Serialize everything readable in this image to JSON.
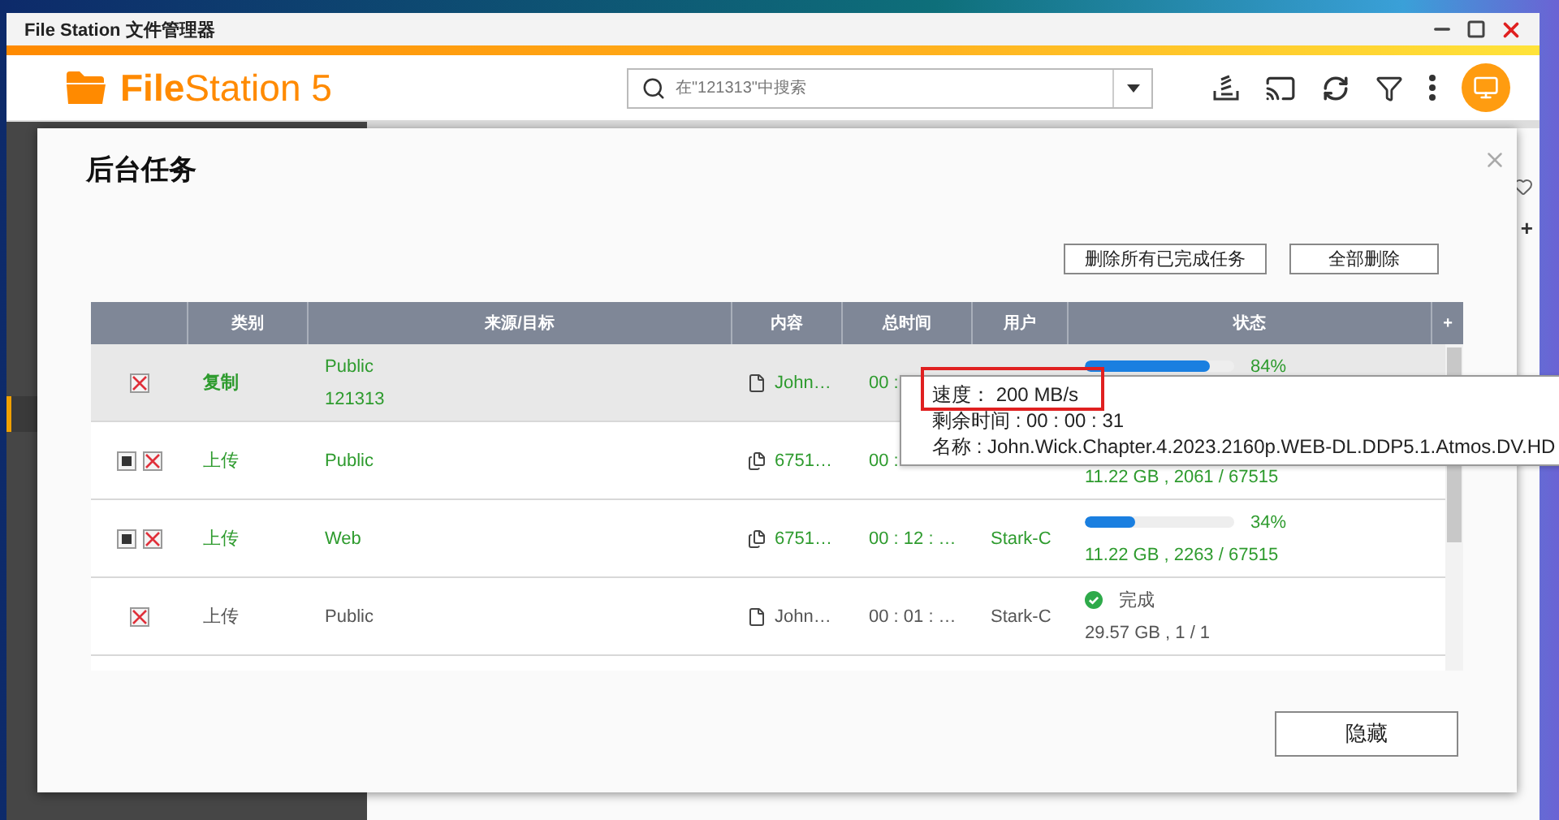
{
  "window": {
    "title": "File Station 文件管理器"
  },
  "app": {
    "logo": "**File**Station 5",
    "search": {
      "placeholder": "在\"121313\"中搜索"
    },
    "side_add": "+"
  },
  "dialog": {
    "title": "后台任务",
    "actions": [
      "删除所有已完成任务",
      "全部删除"
    ],
    "hide_button": "隐藏"
  },
  "table": {
    "columns": [
      "类别",
      "来源/目标",
      "内容",
      "总时间",
      "用户",
      "状态"
    ],
    "add_column": "+",
    "rows": [
      {
        "selected": true,
        "kind": "running",
        "actions": [
          {
            "kind": "cancel"
          }
        ],
        "type": "复制",
        "source": "Public",
        "target": "121313",
        "content": {
          "kind": "file",
          "text": "John…"
        },
        "time": "00 :",
        "level": 0.84,
        "percent": "84%"
      },
      {
        "selected": false,
        "kind": "running",
        "actions": [
          {
            "kind": "stop"
          },
          {
            "kind": "cancel"
          }
        ],
        "type": "上传",
        "source": "Public",
        "content": {
          "kind": "files",
          "text": "6751…"
        },
        "time": "00 :",
        "detail": "11.22 GB , 2061 / 67515"
      },
      {
        "selected": false,
        "kind": "running",
        "actions": [
          {
            "kind": "stop"
          },
          {
            "kind": "cancel"
          }
        ],
        "type": "上传",
        "source": "Web",
        "content": {
          "kind": "files",
          "text": "6751…"
        },
        "time": "00 : 12 : …",
        "user": "Stark-C",
        "level": 0.34,
        "percent": "34%",
        "detail": "11.22 GB , 2263 / 67515"
      },
      {
        "selected": false,
        "kind": "done",
        "actions": [
          {
            "kind": "cancel"
          }
        ],
        "type": "上传",
        "source": "Public",
        "content": {
          "kind": "file",
          "text": "John…"
        },
        "time": "00 : 01 : …",
        "user": "Stark-C",
        "state_label": "完成",
        "detail": "29.57 GB , 1 / 1"
      }
    ]
  },
  "tooltip": {
    "lines": [
      {
        "text": "速度： 200 MB/s",
        "highlighted": true
      },
      {
        "text": "剩余时间 : 00 : 00 : 31",
        "highlighted": false
      },
      {
        "text": "名称 : John.Wick.Chapter.4.2023.2160p.WEB-DL.DDP5.1.Atmos.DV.HD",
        "highlighted": false
      }
    ]
  }
}
